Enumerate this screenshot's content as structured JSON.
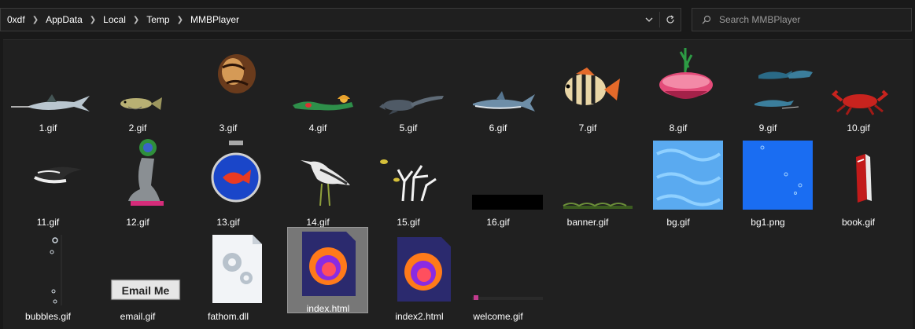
{
  "breadcrumb": [
    "0xdf",
    "AppData",
    "Local",
    "Temp",
    "MMBPlayer"
  ],
  "search": {
    "placeholder": "Search MMBPlayer"
  },
  "files": [
    {
      "name": "1.gif",
      "icon": "swordfish-thumbnail"
    },
    {
      "name": "2.gif",
      "icon": "fish-thumbnail"
    },
    {
      "name": "3.gif",
      "icon": "shell-thumbnail"
    },
    {
      "name": "4.gif",
      "icon": "mermaid-thumbnail"
    },
    {
      "name": "5.gif",
      "icon": "plesiosaur-thumbnail"
    },
    {
      "name": "6.gif",
      "icon": "shark-thumbnail"
    },
    {
      "name": "7.gif",
      "icon": "striped-fish-thumbnail"
    },
    {
      "name": "8.gif",
      "icon": "clam-plant-thumbnail"
    },
    {
      "name": "9.gif",
      "icon": "dolphins-thumbnail"
    },
    {
      "name": "10.gif",
      "icon": "crab-thumbnail"
    },
    {
      "name": "11.gif",
      "icon": "manta-ray-thumbnail"
    },
    {
      "name": "12.gif",
      "icon": "seal-ball-thumbnail"
    },
    {
      "name": "13.gif",
      "icon": "fishbowl-thumbnail"
    },
    {
      "name": "14.gif",
      "icon": "bird-thumbnail"
    },
    {
      "name": "15.gif",
      "icon": "coral-thumbnail"
    },
    {
      "name": "16.gif",
      "icon": "black-bar-thumbnail"
    },
    {
      "name": "banner.gif",
      "icon": "banner-thumbnail"
    },
    {
      "name": "bg.gif",
      "icon": "water-texture-thumbnail"
    },
    {
      "name": "bg1.png",
      "icon": "blue-bubbles-thumbnail"
    },
    {
      "name": "book.gif",
      "icon": "book-thumbnail"
    },
    {
      "name": "bubbles.gif",
      "icon": "bubbles-thumbnail"
    },
    {
      "name": "email.gif",
      "icon": "email-button-thumbnail",
      "text": "Email Me"
    },
    {
      "name": "fathom.dll",
      "icon": "dll-gear-icon"
    },
    {
      "name": "index.html",
      "icon": "firefox-html-icon",
      "selected": true
    },
    {
      "name": "index2.html",
      "icon": "firefox-html-icon"
    },
    {
      "name": "welcome.gif",
      "icon": "welcome-thumbnail"
    }
  ]
}
